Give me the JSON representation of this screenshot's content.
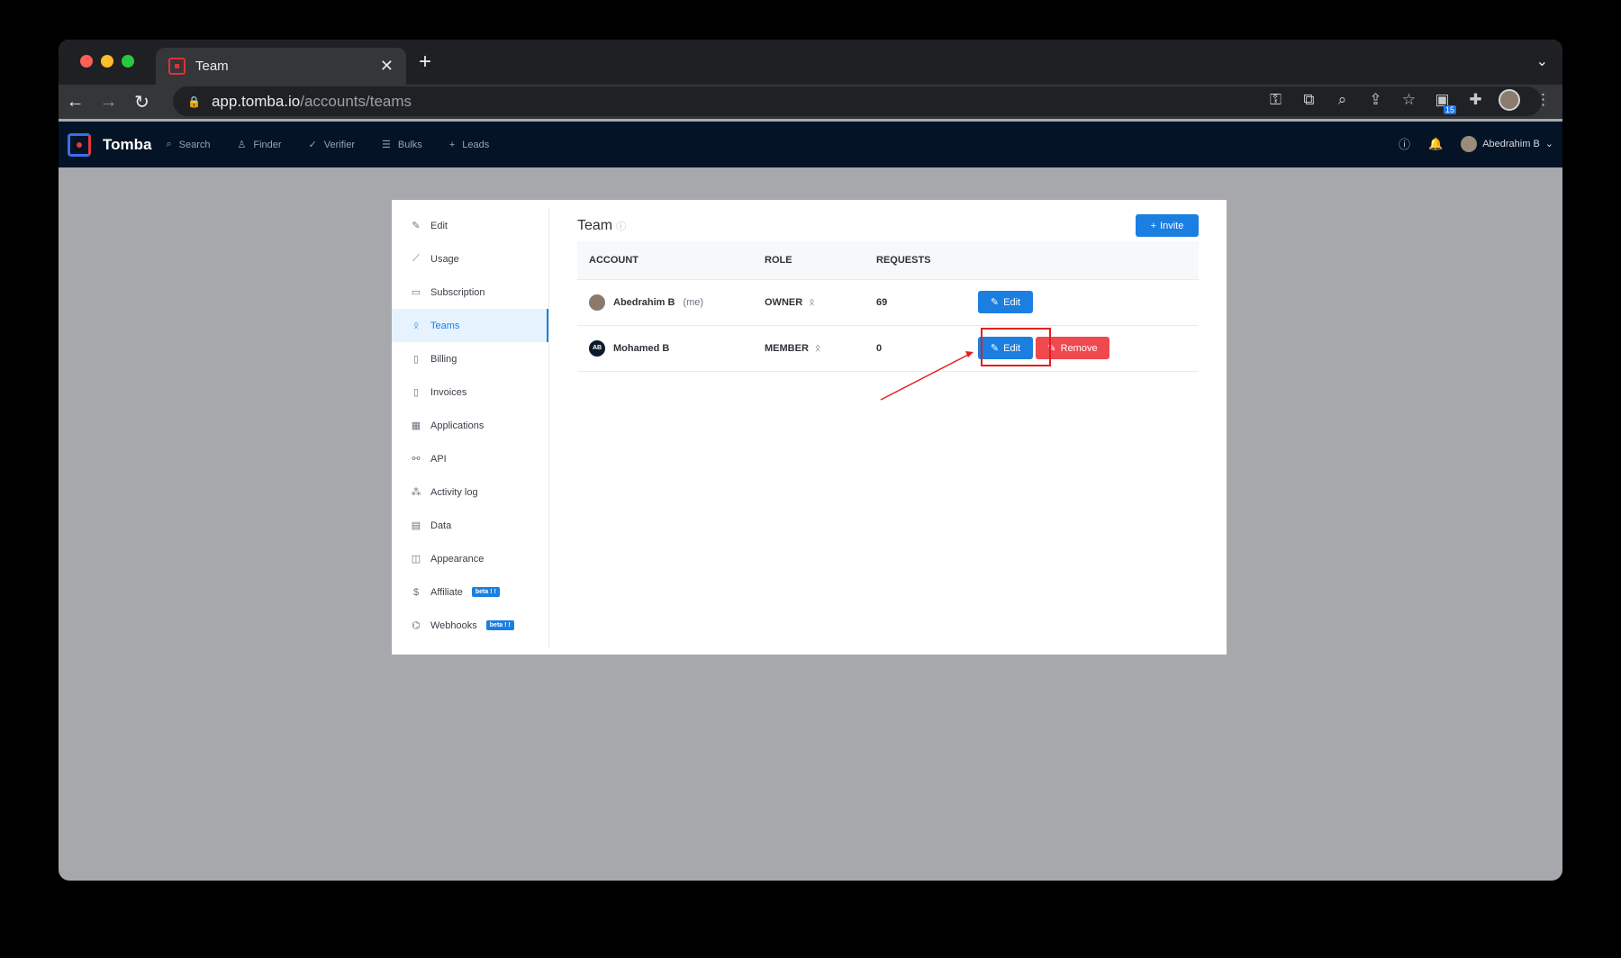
{
  "browser": {
    "tab_title": "Team",
    "new_tab_icon": "plus-icon",
    "url_host": "app.tomba.io",
    "url_path": "/accounts/teams",
    "extension_badge": "15"
  },
  "app": {
    "brand": "Tomba",
    "nav": [
      {
        "label": "Search",
        "icon": "search-icon"
      },
      {
        "label": "Finder",
        "icon": "user-icon"
      },
      {
        "label": "Verifier",
        "icon": "check-icon"
      },
      {
        "label": "Bulks",
        "icon": "list-icon"
      },
      {
        "label": "Leads",
        "icon": "plus-icon"
      }
    ],
    "user_name": "Abedrahim B"
  },
  "sidebar": {
    "items": [
      {
        "label": "Edit",
        "icon": "pencil-icon"
      },
      {
        "label": "Usage",
        "icon": "chart-icon"
      },
      {
        "label": "Subscription",
        "icon": "card-icon"
      },
      {
        "label": "Teams",
        "icon": "team-icon"
      },
      {
        "label": "Billing",
        "icon": "file-icon"
      },
      {
        "label": "Invoices",
        "icon": "document-icon"
      },
      {
        "label": "Applications",
        "icon": "apps-icon"
      },
      {
        "label": "API",
        "icon": "link-icon"
      },
      {
        "label": "Activity log",
        "icon": "activity-icon"
      },
      {
        "label": "Data",
        "icon": "database-icon"
      },
      {
        "label": "Appearance",
        "icon": "layout-icon"
      },
      {
        "label": "Affiliate",
        "icon": "dollar-icon",
        "badge": "beta ! !"
      },
      {
        "label": "Webhooks",
        "icon": "webhook-icon",
        "badge": "beta ! !"
      }
    ],
    "active": "Teams"
  },
  "main": {
    "title": "Team",
    "invite_label": "Invite",
    "columns": [
      "ACCOUNT",
      "ROLE",
      "REQUESTS"
    ],
    "rows": [
      {
        "name": "Abedrahim B",
        "suffix": "(me)",
        "role": "OWNER",
        "requests": "69",
        "edit_label": "Edit"
      },
      {
        "name": "Mohamed B",
        "initials": "AB",
        "role": "MEMBER",
        "requests": "0",
        "edit_label": "Edit",
        "remove_label": "Remove"
      }
    ]
  },
  "colors": {
    "accent": "#1a7fe0",
    "danger": "#f0484f",
    "annotation": "#e02020"
  }
}
